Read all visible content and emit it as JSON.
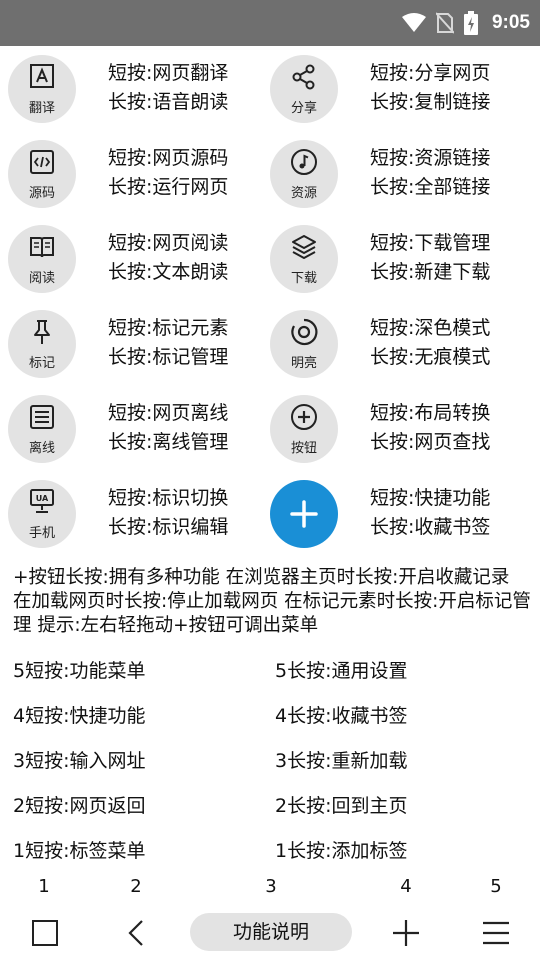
{
  "status": {
    "time": "9:05"
  },
  "grid": [
    {
      "left": {
        "label": "翻译",
        "icon": "translate-icon",
        "short": "短按:网页翻译",
        "long": "长按:语音朗读"
      },
      "right": {
        "label": "分享",
        "icon": "share-icon",
        "short": "短按:分享网页",
        "long": "长按:复制链接"
      }
    },
    {
      "left": {
        "label": "源码",
        "icon": "source-code-icon",
        "short": "短按:网页源码",
        "long": "长按:运行网页"
      },
      "right": {
        "label": "资源",
        "icon": "music-note-icon",
        "short": "短按:资源链接",
        "long": "长按:全部链接"
      }
    },
    {
      "left": {
        "label": "阅读",
        "icon": "book-icon",
        "short": "短按:网页阅读",
        "long": "长按:文本朗读"
      },
      "right": {
        "label": "下载",
        "icon": "layers-icon",
        "short": "短按:下载管理",
        "long": "长按:新建下载"
      }
    },
    {
      "left": {
        "label": "标记",
        "icon": "pin-icon",
        "short": "短按:标记元素",
        "long": "长按:标记管理"
      },
      "right": {
        "label": "明亮",
        "icon": "brightness-icon",
        "short": "短按:深色模式",
        "long": "长按:无痕模式"
      }
    },
    {
      "left": {
        "label": "离线",
        "icon": "offline-page-icon",
        "short": "短按:网页离线",
        "long": "长按:离线管理"
      },
      "right": {
        "label": "按钮",
        "icon": "plus-circle-icon",
        "short": "短按:布局转换",
        "long": "长按:网页查找"
      }
    },
    {
      "left": {
        "label": "手机",
        "icon": "user-agent-icon",
        "short": "短按:标识切换",
        "long": "长按:标识编辑"
      },
      "right": {
        "label": "",
        "icon": "plus-icon",
        "short": "短按:快捷功能",
        "long": "长按:收藏书签"
      }
    }
  ],
  "note": "+按钮长按:拥有多种功能 在浏览器主页时长按:开启收藏记录 在加载网页时长按:停止加载网页 在标记元素时长按:开启标记管理 提示:左右轻拖动+按钮可调出菜单",
  "gestures": [
    {
      "short": "5短按:功能菜单",
      "long": "5长按:通用设置"
    },
    {
      "short": "4短按:快捷功能",
      "long": "4长按:收藏书签"
    },
    {
      "short": "3短按:输入网址",
      "long": "3长按:重新加载"
    },
    {
      "short": "2短按:网页返回",
      "long": "2长按:回到主页"
    },
    {
      "short": "1短按:标签菜单",
      "long": "1长按:添加标签"
    }
  ],
  "numbers": [
    "1",
    "2",
    "3",
    "4",
    "5"
  ],
  "bottombar": {
    "center_label": "功能说明"
  },
  "colors": {
    "statusbar": "#6f6f6f",
    "accent": "#1a8fd6",
    "circle": "#e3e3e3"
  }
}
